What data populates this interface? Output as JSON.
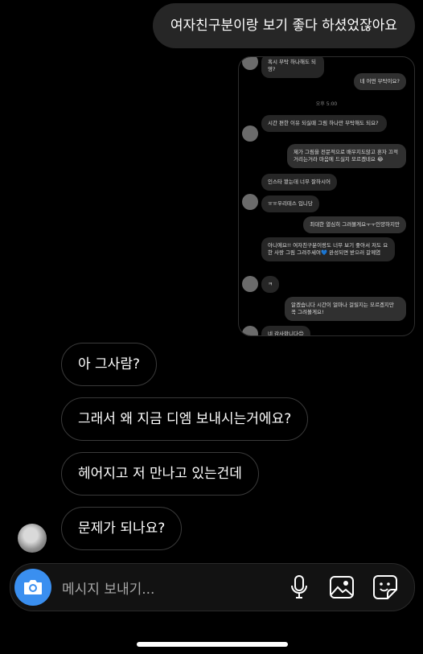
{
  "outgoing": {
    "text": "여자친구분이랑 보기 좋다 하셨었잖아요"
  },
  "shared_screenshot": {
    "messages": [
      {
        "side": "in",
        "text": "혹시 부탁 하나해도 되영?"
      },
      {
        "side": "out",
        "text": "네 어떤 부탁이요?"
      },
      {
        "side": "time",
        "text": "오후 5:00"
      },
      {
        "side": "in",
        "text": "시간 편한 이유 되실때 그림 하나만 부탁해도 되요?"
      },
      {
        "side": "out",
        "text": "제가 그림을 전문적으로 배우지도않고 혼자 끄적거리는거라 마음에 드실지 모르겠네요 😂"
      },
      {
        "side": "in",
        "text": "인스타 봤는데 너무 잘하시어"
      },
      {
        "side": "in",
        "text": "ㅠㅠ우리테스 입니당"
      },
      {
        "side": "out",
        "text": "최대한 열심히 그려볼게요ㅜㅜ인양하지만"
      },
      {
        "side": "in",
        "text": "아니에요!! 여자친구분이랑도 너무 보기 좋아서 저도 요한 사랑 그림 그려주세여💙 완성되면 받으러 갈께염"
      },
      {
        "side": "in",
        "text": "ㅋ"
      },
      {
        "side": "out",
        "text": "알겠습니다 시간이 얼마나 걸릴지는 모르겠지만 꼭 그려볼게요!"
      },
      {
        "side": "in",
        "text": "네 감사합니다😊"
      }
    ]
  },
  "incoming": [
    {
      "text": "아 그사람?"
    },
    {
      "text": "그래서 왜 지금 디엠 보내시는거에요?"
    },
    {
      "text": "헤어지고 저 만나고 있는건데"
    },
    {
      "text": "문제가 되나요?"
    }
  ],
  "composer": {
    "placeholder": "메시지 보내기..."
  },
  "colors": {
    "accent": "#3a8ff0",
    "bubble_out": "#262626",
    "bubble_in_border": "#3a3a3a"
  }
}
